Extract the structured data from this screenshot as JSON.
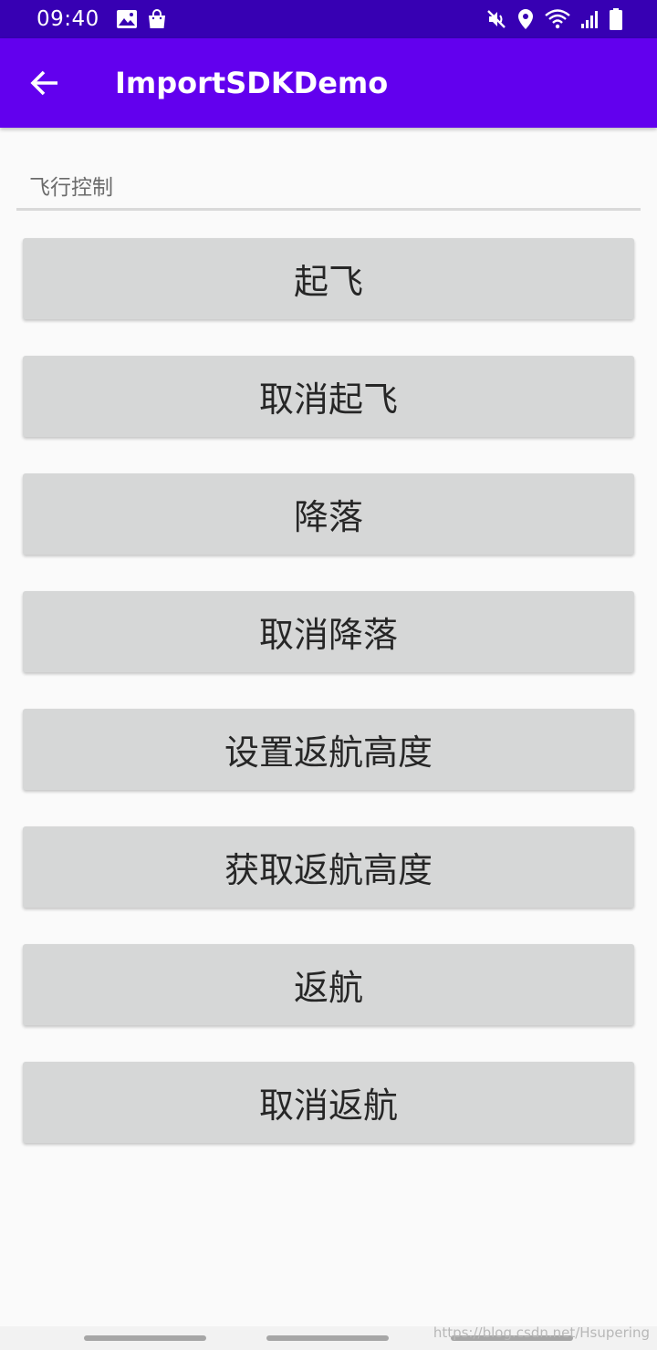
{
  "status_bar": {
    "time": "09:40",
    "left_icons": [
      "image-icon",
      "shopping-bag-icon"
    ],
    "right_icons": [
      "mute-icon",
      "location-icon",
      "wifi-icon",
      "signal-icon",
      "battery-icon"
    ]
  },
  "app_bar": {
    "title": "ImportSDKDemo",
    "back_icon": "arrow-left-icon"
  },
  "section": {
    "label": "飞行控制"
  },
  "buttons": [
    {
      "label": "起飞"
    },
    {
      "label": "取消起飞"
    },
    {
      "label": "降落"
    },
    {
      "label": "取消降落"
    },
    {
      "label": "设置返航高度"
    },
    {
      "label": "获取返航高度"
    },
    {
      "label": "返航"
    },
    {
      "label": "取消返航"
    }
  ],
  "watermark": "https://blog.csdn.net/Hsupering",
  "colors": {
    "status_bar": "#3700b3",
    "app_bar": "#6200ee",
    "button_bg": "#d6d7d7",
    "background": "#fafafa"
  }
}
